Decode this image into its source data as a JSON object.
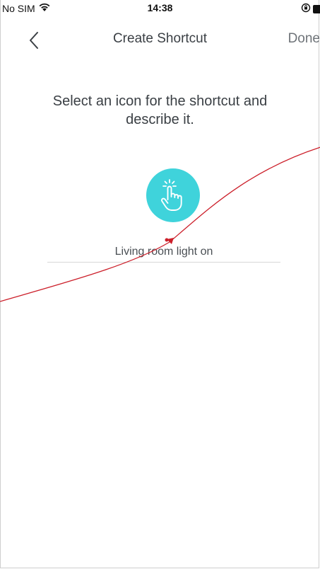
{
  "status_bar": {
    "carrier": "No SIM",
    "time": "14:38",
    "wifi_icon": "wifi-icon",
    "orientation_lock_icon": "orientation-lock-icon",
    "battery_icon": "battery-icon"
  },
  "nav": {
    "back_icon": "chevron-left-icon",
    "title": "Create Shortcut",
    "done_label": "Done"
  },
  "main": {
    "prompt": "Select an icon for the shortcut and describe it.",
    "selected_icon": "tap-hand-icon",
    "icon_color": "#3fd3db",
    "description_value": "Living room light on"
  },
  "annotation": {
    "color": "#cc1f2a"
  }
}
